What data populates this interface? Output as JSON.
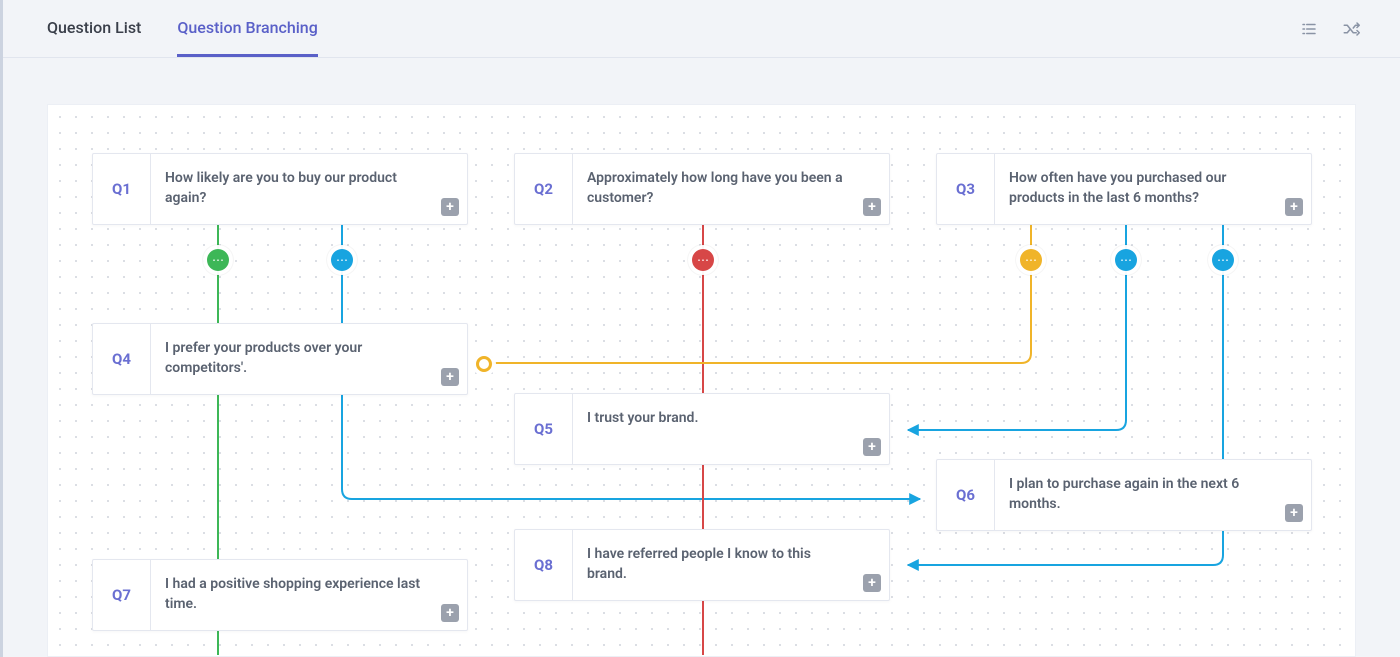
{
  "tabs": {
    "list_label": "Question List",
    "branch_label": "Question Branching",
    "active": "branch"
  },
  "header_icons": {
    "list_icon": "list-icon",
    "shuffle_icon": "shuffle-icon"
  },
  "questions": {
    "q1": {
      "code": "Q1",
      "text": "How likely are you to buy our product again?"
    },
    "q2": {
      "code": "Q2",
      "text": "Approximately how long have you been a customer?"
    },
    "q3": {
      "code": "Q3",
      "text": "How often have you purchased our products in the last 6 months?"
    },
    "q4": {
      "code": "Q4",
      "text": "I prefer your products over your competitors'."
    },
    "q5": {
      "code": "Q5",
      "text": "I trust your brand."
    },
    "q6": {
      "code": "Q6",
      "text": "I plan to purchase again in the next 6 months."
    },
    "q7": {
      "code": "Q7",
      "text": "I had a positive shopping experience last time."
    },
    "q8": {
      "code": "Q8",
      "text": "I have referred people I know to this brand."
    }
  },
  "branch_nodes": [
    {
      "id": "n1",
      "color": "green"
    },
    {
      "id": "n2",
      "color": "blue"
    },
    {
      "id": "n3",
      "color": "red"
    },
    {
      "id": "n4",
      "color": "orange"
    },
    {
      "id": "n5",
      "color": "blue"
    },
    {
      "id": "n6",
      "color": "blue"
    },
    {
      "id": "n7",
      "color": "orange-ring"
    }
  ],
  "colors": {
    "accent": "#5a60c8",
    "node_green": "#3db757",
    "node_blue": "#18a4e0",
    "node_red": "#d74747",
    "node_orange": "#f0b429",
    "canvas_dot": "#cfd3db"
  },
  "chart_data": {
    "type": "graph",
    "nodes": [
      {
        "id": "Q1",
        "label": "How likely are you to buy our product again?"
      },
      {
        "id": "Q2",
        "label": "Approximately how long have you been a customer?"
      },
      {
        "id": "Q3",
        "label": "How often have you purchased our products in the last 6 months?"
      },
      {
        "id": "Q4",
        "label": "I prefer your products over your competitors'."
      },
      {
        "id": "Q5",
        "label": "I trust your brand."
      },
      {
        "id": "Q6",
        "label": "I plan to purchase again in the next 6 months."
      },
      {
        "id": "Q7",
        "label": "I had a positive shopping experience last time."
      },
      {
        "id": "Q8",
        "label": "I have referred people I know to this brand."
      }
    ],
    "edges": [
      {
        "from": "Q1",
        "to": "Q4",
        "color": "green"
      },
      {
        "from": "Q1",
        "to": "Q6",
        "color": "blue"
      },
      {
        "from": "Q2",
        "to": "Q5",
        "color": "red"
      },
      {
        "from": "Q2",
        "to": "Q8",
        "color": "red"
      },
      {
        "from": "Q3",
        "to": "Q4",
        "color": "orange"
      },
      {
        "from": "Q3",
        "to": "Q5",
        "color": "blue"
      },
      {
        "from": "Q3",
        "to": "Q8",
        "color": "blue"
      },
      {
        "from": "Q4",
        "to": "Q7",
        "color": "green"
      }
    ]
  }
}
